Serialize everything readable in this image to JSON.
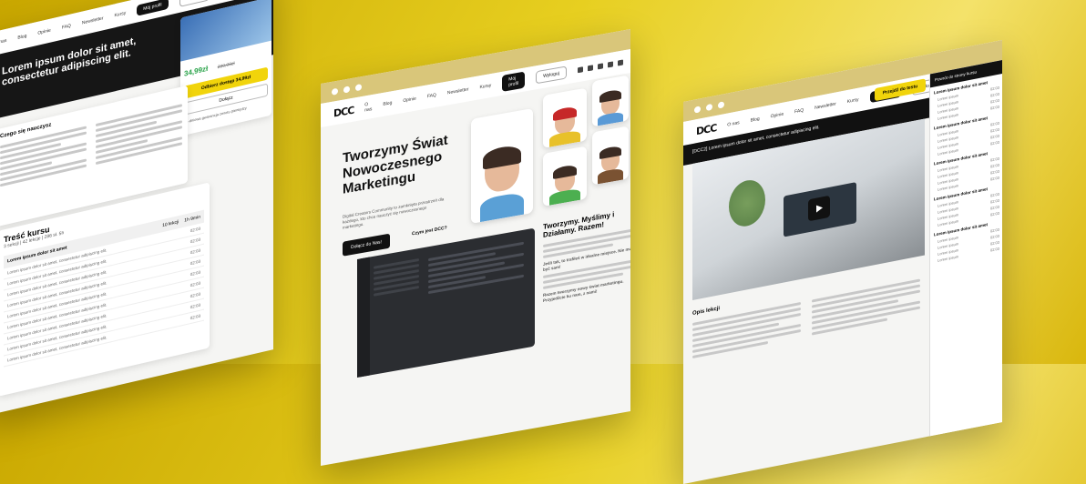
{
  "nav": {
    "logo": "DCC",
    "items": [
      "O nas",
      "Blog",
      "Opinie",
      "FAQ",
      "Newsletter",
      "Kursy"
    ],
    "my_profile": "Mój profil",
    "logout": "Wyloguj"
  },
  "left": {
    "hero_title": "Lorem ipsum dolor sit amet, consectetur adipiscing elit.",
    "price": "34,99zł",
    "old_price": "299,00zł",
    "buy_button": "Odbierz dostęp 34,99zł",
    "secondary_button": "Dołącz",
    "guarantee": "14-dniowa gwarancja zwrotu pieniędzy",
    "learn_title": "Czego się nauczysz",
    "content_title": "Treść kursu",
    "content_meta": "3 sekcji | 42 lekcje | 286 sł. 5h",
    "section_title": "Lorem ipsum dolor sit amet",
    "section_meta": "10 lekcji",
    "section_time": "1h 9min",
    "lesson_label": "Lorem ipsum dolor sit amet, consectetur adipiscing elit.",
    "times": [
      "02:03",
      "02:03",
      "02:03",
      "02:03",
      "02:03",
      "02:03",
      "02:03",
      "02:03",
      "02:03"
    ]
  },
  "mid": {
    "hero_title": "Tworzymy Świat Nowoczesnego Marketingu",
    "hero_desc": "Digital Creators Community to zamknięta przestrzeń dla każdego, kto chce nauczyć się nowoczesnego marketingu.",
    "join_button": "Dołącz do Nas!",
    "what_button": "Czym jest DCC?",
    "section_title": "Tworzymy. Myślimy i Działamy. Razem!",
    "para_bold_1": "Jeśli tak, to trafiłeś w idealne miejsce. Nie musisz być sam!",
    "para_bold_2": "Razem tworzymy nowy świat marketingu. Przyjedźcie ku nam, z nami!"
  },
  "right": {
    "lesson_title": "[DCC2] Lorem ipsum dolor sit amet, consectetur adipiscing elit.",
    "next_button": "Przejdź do testu",
    "back": "Powrót do strony kursu",
    "about_title": "Opis lekcji",
    "sections": [
      "Lorem ipsum dolor sit amet",
      "Lorem ipsum dolor sit amet",
      "Lorem ipsum dolor sit amet",
      "Lorem ipsum dolor sit amet",
      "Lorem ipsum dolor sit amet"
    ],
    "lesson_item": "Lorem ipsum",
    "time": "02:03"
  },
  "colors": {
    "accent": "#f1d40b",
    "dark": "#121212",
    "chrome": "#d9c67a"
  }
}
